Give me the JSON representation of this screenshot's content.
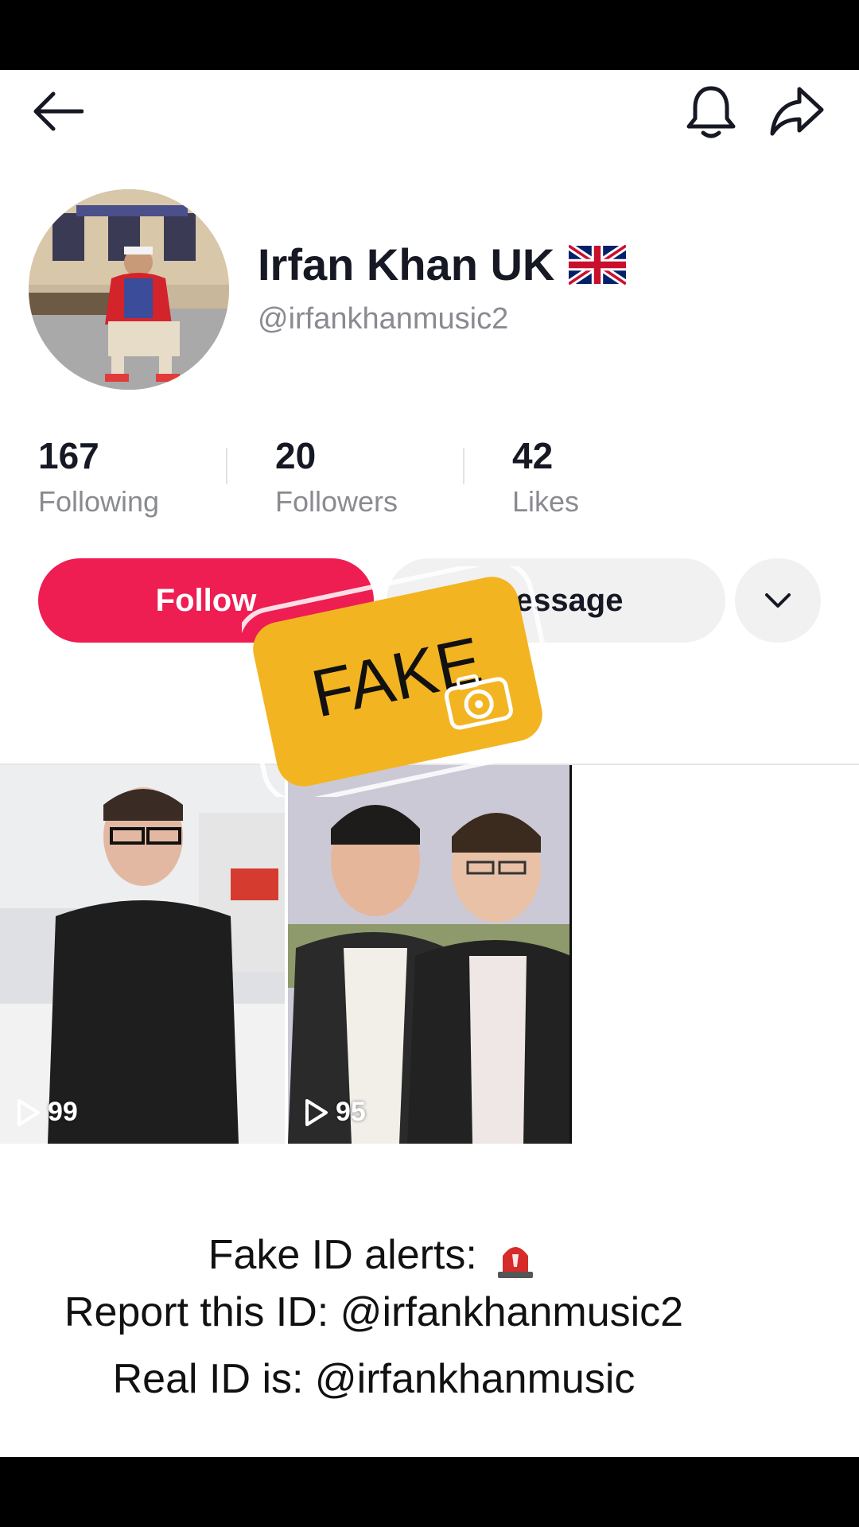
{
  "header": {
    "back_icon": "back-arrow-icon",
    "bell_icon": "bell-icon",
    "share_icon": "share-arrow-icon"
  },
  "profile": {
    "display_name": "Irfan Khan UK",
    "flag_icon": "uk-flag-icon",
    "username": "@irfankhanmusic2"
  },
  "stats": [
    {
      "value": "167",
      "label": "Following"
    },
    {
      "value": "20",
      "label": "Followers"
    },
    {
      "value": "42",
      "label": "Likes"
    }
  ],
  "actions": {
    "follow_label": "Follow",
    "message_label": "Message",
    "dropdown_icon": "chevron-down-icon"
  },
  "overlay": {
    "stamp_text": "FAKE",
    "stamp_color": "#f3b421"
  },
  "videos": [
    {
      "plays": "99"
    },
    {
      "plays": "95"
    }
  ],
  "caption": {
    "line1": "Fake ID alerts:",
    "line1_icon": "siren-icon",
    "line2": "Report this ID: @irfankhanmusic2",
    "line3": "Real ID is: @irfankhanmusic"
  },
  "colors": {
    "follow_button": "#ee1d52",
    "secondary_button": "#f1f1f2",
    "muted_text": "#8a8b91"
  }
}
